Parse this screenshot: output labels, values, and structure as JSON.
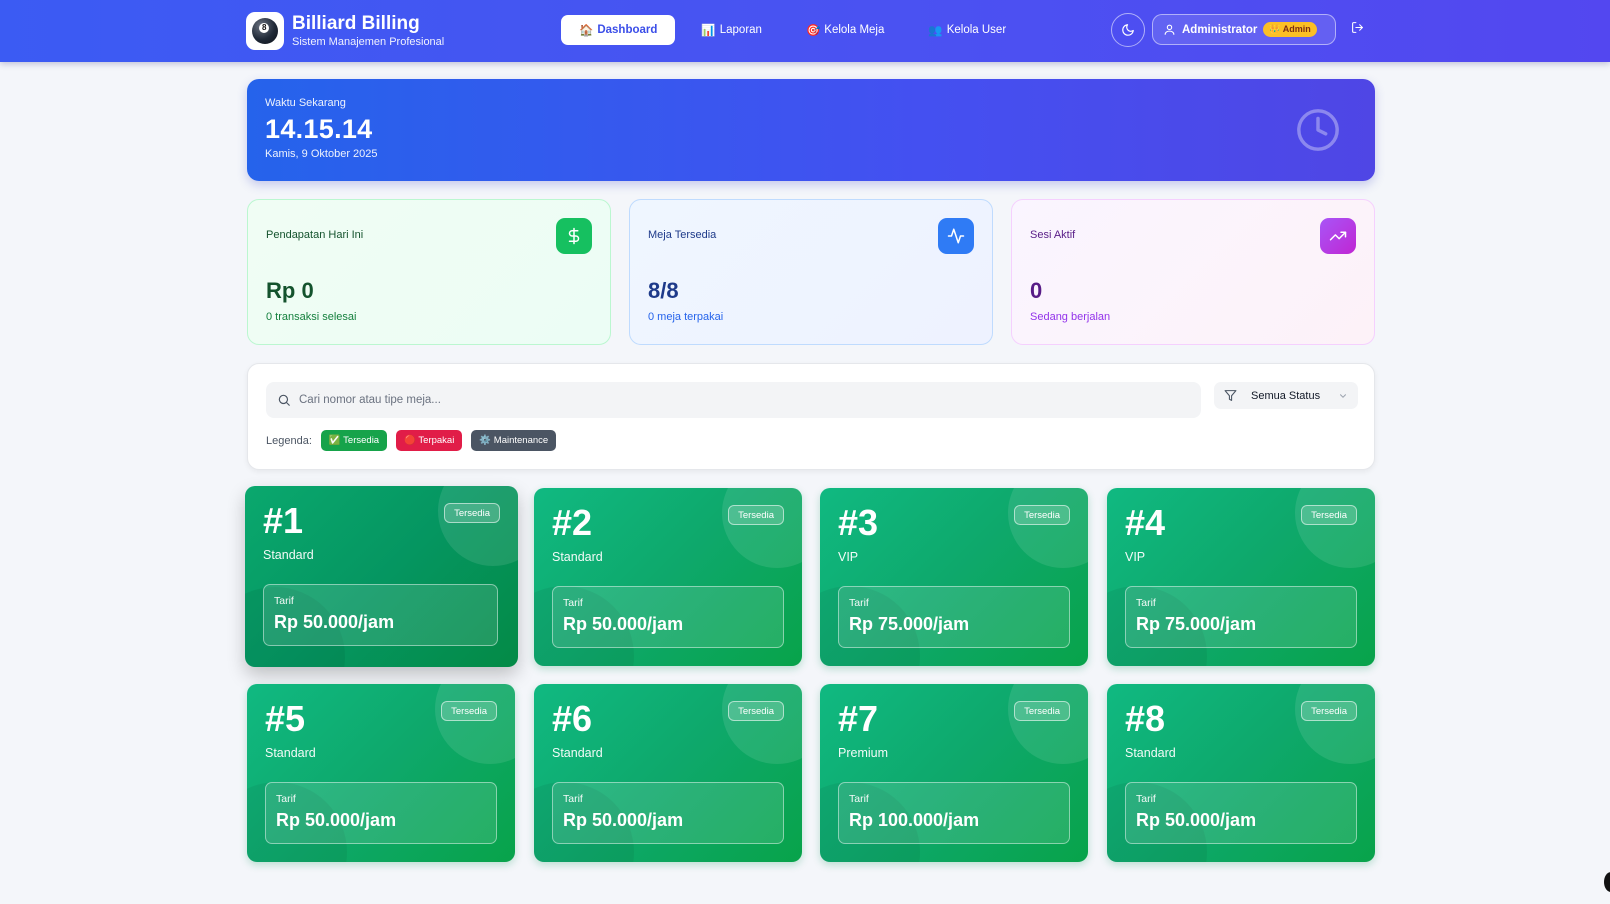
{
  "header": {
    "brand_title": "Billiard Billing",
    "brand_subtitle": "Sistem Manajemen Profesional",
    "logo_ball_number": "8",
    "nav": [
      {
        "label": "Dashboard",
        "icon": "🏠",
        "active": true
      },
      {
        "label": "Laporan",
        "icon": "📊",
        "active": false
      },
      {
        "label": "Kelola Meja",
        "icon": "🎯",
        "active": false
      },
      {
        "label": "Kelola User",
        "icon": "👥",
        "active": false
      }
    ],
    "user_name": "Administrator",
    "user_role": "👑 Admin"
  },
  "clock": {
    "label": "Waktu Sekarang",
    "time": "14.15.14",
    "date": "Kamis, 9 Oktober 2025"
  },
  "stats": {
    "revenue": {
      "label": "Pendapatan Hari Ini",
      "value": "Rp 0",
      "sub": "0 transaksi selesai"
    },
    "tables": {
      "label": "Meja Tersedia",
      "value": "8/8",
      "sub": "0 meja terpakai"
    },
    "sessions": {
      "label": "Sesi Aktif",
      "value": "0",
      "sub": "Sedang berjalan"
    }
  },
  "filter": {
    "search_placeholder": "Cari nomor atau tipe meja...",
    "status_value": "Semua Status",
    "legend_label": "Legenda:",
    "legend": [
      {
        "label": "✅ Tersedia"
      },
      {
        "label": "🔴 Terpakai"
      },
      {
        "label": "⚙️ Maintenance"
      }
    ]
  },
  "tables": [
    {
      "number": "#1",
      "type": "Standard",
      "status": "Tersedia",
      "tarif_label": "Tarif",
      "tarif": "Rp 50.000/jam"
    },
    {
      "number": "#2",
      "type": "Standard",
      "status": "Tersedia",
      "tarif_label": "Tarif",
      "tarif": "Rp 50.000/jam"
    },
    {
      "number": "#3",
      "type": "VIP",
      "status": "Tersedia",
      "tarif_label": "Tarif",
      "tarif": "Rp 75.000/jam"
    },
    {
      "number": "#4",
      "type": "VIP",
      "status": "Tersedia",
      "tarif_label": "Tarif",
      "tarif": "Rp 75.000/jam"
    },
    {
      "number": "#5",
      "type": "Standard",
      "status": "Tersedia",
      "tarif_label": "Tarif",
      "tarif": "Rp 50.000/jam"
    },
    {
      "number": "#6",
      "type": "Standard",
      "status": "Tersedia",
      "tarif_label": "Tarif",
      "tarif": "Rp 50.000/jam"
    },
    {
      "number": "#7",
      "type": "Premium",
      "status": "Tersedia",
      "tarif_label": "Tarif",
      "tarif": "Rp 100.000/jam"
    },
    {
      "number": "#8",
      "type": "Standard",
      "status": "Tersedia",
      "tarif_label": "Tarif",
      "tarif": "Rp 50.000/jam"
    }
  ],
  "colors": {
    "primary": "#4a52f2",
    "available": "#10b981",
    "occupied": "#e11d48",
    "maintenance": "#4b5563"
  }
}
